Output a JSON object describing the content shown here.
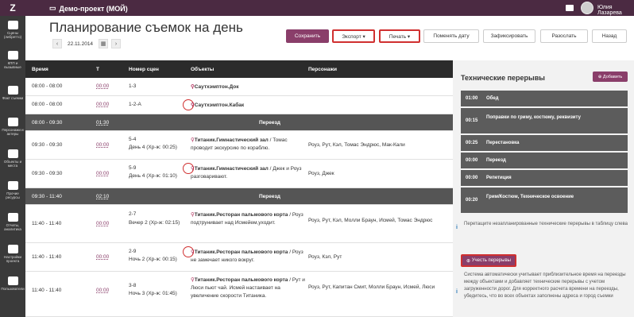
{
  "app": {
    "logo": "Z",
    "project": "Демо-проект (МОЙ)",
    "user": "Юлия Лазарева"
  },
  "sidebar": [
    {
      "label": "Сцены (либретто)",
      "icon": "film-icon"
    },
    {
      "label": "КПП и вызывные",
      "icon": "clipboard-icon"
    },
    {
      "label": "Факт съемки",
      "icon": "camera-icon"
    },
    {
      "label": "Персонажи и актеры",
      "icon": "users-icon"
    },
    {
      "label": "Объекты и места",
      "icon": "image-icon"
    },
    {
      "label": "Прочие ресурсы",
      "icon": "box-icon"
    },
    {
      "label": "Отчеты, аналитика",
      "icon": "chart-icon"
    },
    {
      "label": "Настройки проекта",
      "icon": "settings-icon"
    },
    {
      "label": "Пользователи",
      "icon": "user-group-icon"
    }
  ],
  "page": {
    "title": "Планирование съемок на день",
    "date": "22.11.2014"
  },
  "toolbar": {
    "save": "Сохранить",
    "export": "Экспорт ▾",
    "print": "Печать ▾",
    "change_date": "Поменять дату",
    "fix": "Зафиксировать",
    "send": "Разослать",
    "back": "Назад"
  },
  "table": {
    "headers": {
      "time": "Время",
      "t": "Т",
      "scene": "Номер сцен",
      "objects": "Объекты",
      "characters": "Персонажи"
    },
    "rows": [
      {
        "time": "08:00 - 08:00",
        "t": "00:00",
        "scene": "1-3",
        "object": "Саутхэмптон.Док",
        "object_rest": "",
        "chars": ""
      },
      {
        "time": "08:00 - 08:00",
        "t": "00:00",
        "scene": "1-2-А",
        "object": "Саутхэмптон.Кабак",
        "object_rest": "",
        "chars": ""
      },
      {
        "time": "08:00 - 09:30",
        "t": "01:30",
        "sep": "Переезд"
      },
      {
        "time": "09:30 - 09:30",
        "t": "00:00",
        "scene": "5-4",
        "scene2": "День 4 (Хр-ж: 00:25)",
        "object": "Титаник.Гимнастический зал",
        "object_rest": " / Томас проводит экскурсию по кораблю.",
        "chars": "Роуз, Рут, Кэл, Томас Эндрюс, Мак-Кали"
      },
      {
        "time": "09:30 - 09:30",
        "t": "00:00",
        "scene": "5-9",
        "scene2": "День 4 (Хр-ж: 01:10)",
        "object": "Титаник.Гимнастический зал",
        "object_rest": " / Джек и Роуз разговаривают.",
        "chars": "Роуз, Джек"
      },
      {
        "time": "09:30 - 11:40",
        "t": "02:10",
        "sep": "Переезд"
      },
      {
        "time": "11:40 - 11:40",
        "t": "00:00",
        "scene": "2-7",
        "scene2": "Вечер 2 (Хр-ж: 02:15)",
        "object": "Титаник.Ресторан пальмового корта",
        "object_rest": " / Роуз подтрунивает над Исмейем,уходит.",
        "chars": "Роуз, Рут, Кэл, Молли Браун, Исмей, Томас Эндрюс"
      },
      {
        "time": "11:40 - 11:40",
        "t": "00:00",
        "scene": "2-9",
        "scene2": "Ночь 2 (Хр-ж: 00:15)",
        "object": "Титаник.Ресторан пальмового корта",
        "object_rest": " / Роуз не замечает никого вокруг.",
        "chars": "Роуз, Кэл, Рут"
      },
      {
        "time": "11:40 - 11:40",
        "t": "00:00",
        "scene": "3-8",
        "scene2": "Ночь 3 (Хр-ж: 01:45)",
        "object": "Титаник.Ресторан пальмового корта",
        "object_rest": " / Рут и Люси пьют чай. Исмей настаивает на увеличение скорости Титаника.",
        "chars": "Роуз, Рут, Капитан Смит, Молли Браун, Исмей, Люси"
      }
    ]
  },
  "panel": {
    "title": "Технические перерывы",
    "add": "Добавить",
    "breaks": [
      {
        "time": "01:00",
        "name": "Обед"
      },
      {
        "time": "00:15",
        "name": "Поправки по гриму, костюму, реквизиту"
      },
      {
        "time": "00:25",
        "name": "Перестановка"
      },
      {
        "time": "00:00",
        "name": "Переезд"
      },
      {
        "time": "00:00",
        "name": "Репетиция"
      },
      {
        "time": "00:20",
        "name": "Грим/Костюм, Техническое освоение"
      }
    ],
    "hint1": "Перетащите незапланированные технические перерывы в таблицу слева",
    "calc": "Учесть перерывы",
    "hint2": "Система автоматически учитывает приблизительное время на переезды между объектами и добавляет технические перерывы с учетом загруженности дорог. Для корректного расчета времени на переезды, убедитесь, что во всех объектах заполнены адреса и город съемки"
  }
}
